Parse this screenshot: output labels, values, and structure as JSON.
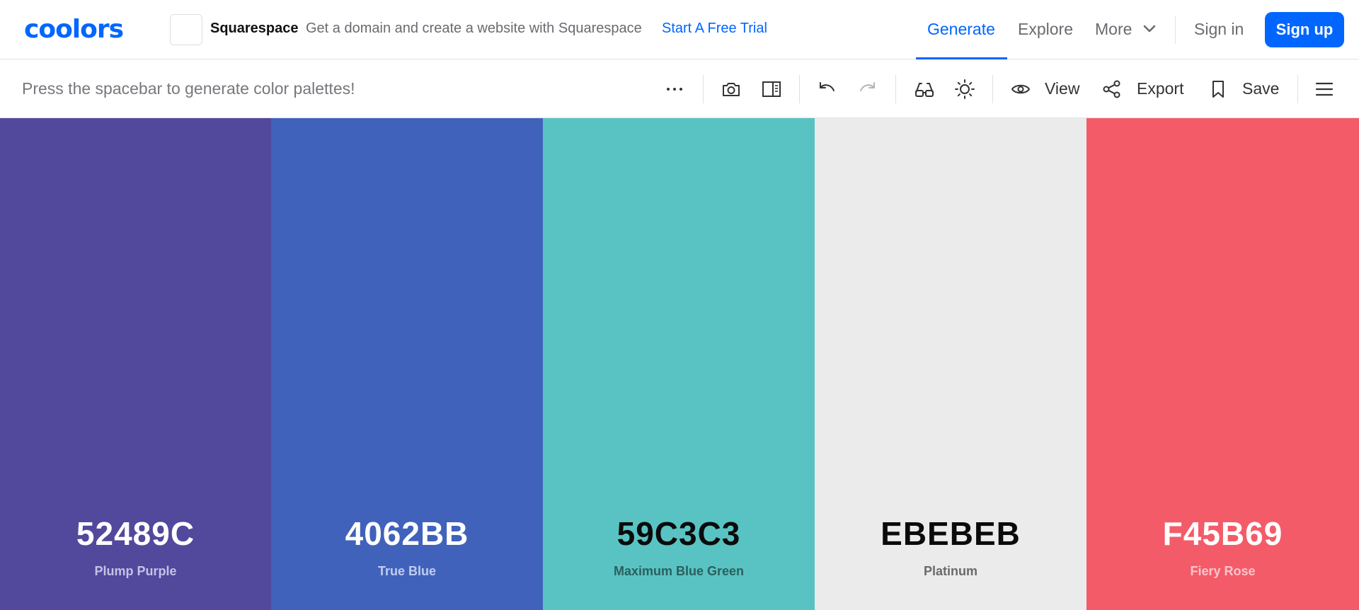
{
  "brand": {
    "logo_text": "coolors"
  },
  "ad": {
    "brand": "Squarespace",
    "text": "Get a domain and create a website with Squarespace",
    "cta": "Start A Free Trial"
  },
  "nav": {
    "generate": "Generate",
    "explore": "Explore",
    "more": "More",
    "sign_in": "Sign in",
    "sign_up": "Sign up"
  },
  "toolbar": {
    "hint": "Press the spacebar to generate color palettes!",
    "view": "View",
    "export": "Export",
    "save": "Save",
    "icons": [
      "more-dots-icon",
      "camera-icon",
      "panel-icon",
      "undo-icon",
      "redo-icon",
      "glasses-icon",
      "sun-icon",
      "eye-icon",
      "share-icon",
      "bookmark-icon",
      "hamburger-menu-icon"
    ]
  },
  "colors": {
    "accent": "#0066ff"
  },
  "palette": [
    {
      "hex": "52489C",
      "name": "Plump Purple",
      "bg": "#52489C",
      "hex_color": "#ffffff",
      "name_color": "#c6c2e6"
    },
    {
      "hex": "4062BB",
      "name": "True Blue",
      "bg": "#4062BB",
      "hex_color": "#ffffff",
      "name_color": "#c0cdf0"
    },
    {
      "hex": "59C3C3",
      "name": "Maximum Blue Green",
      "bg": "#59C3C3",
      "hex_color": "#0b0b0b",
      "name_color": "#2b5f5f"
    },
    {
      "hex": "EBEBEB",
      "name": "Platinum",
      "bg": "#EBEBEB",
      "hex_color": "#0b0b0b",
      "name_color": "#6a6a6a"
    },
    {
      "hex": "F45B69",
      "name": "Fiery Rose",
      "bg": "#F45B69",
      "hex_color": "#ffffff",
      "name_color": "#fbc6cb"
    }
  ]
}
